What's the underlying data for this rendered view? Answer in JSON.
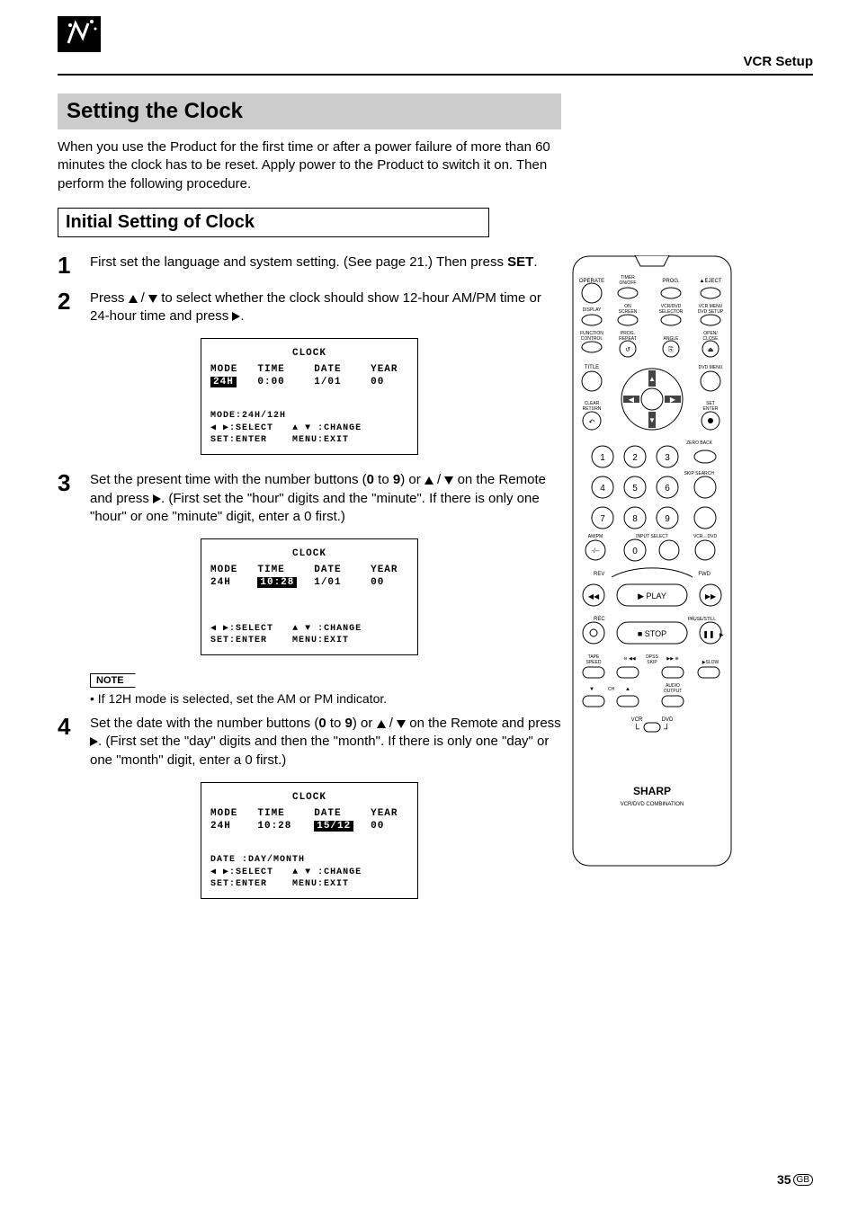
{
  "header": {
    "section": "VCR Setup"
  },
  "title": "Setting the Clock",
  "intro": "When you use the Product for the first time or after a power failure of more than 60 minutes the clock has to be reset. Apply power to the Product to switch it on. Then perform the following procedure.",
  "subtitle": "Initial Setting of Clock",
  "steps": {
    "1": {
      "num": "1",
      "text_a": "First set the language and system setting. (See page 21.) Then press ",
      "text_b": "SET",
      "text_c": "."
    },
    "2": {
      "num": "2",
      "text_a": "Press ",
      "text_b": " to select whether the clock should show 12-hour AM/PM time or 24-hour time and press "
    },
    "3": {
      "num": "3",
      "text_a": "Set the present time with the number buttons (",
      "text_b": "0",
      "text_c": " to ",
      "text_d": "9",
      "text_e": ") or ",
      "text_f": " on the Remote and press ",
      "text_g": ". (First set the \"hour\" digits and the \"minute\". If there is only one \"hour\" or one \"minute\" digit, enter a 0 first.)"
    },
    "4": {
      "num": "4",
      "text_a": "Set the date with the number buttons (",
      "text_b": "0",
      "text_c": " to ",
      "text_d": "9",
      "text_e": ")  or ",
      "text_f": " on the Remote and press ",
      "text_g": ". (First set the \"day\" digits and then the \"month\". If there is only one \"day\" or one \"month\" digit, enter a 0 first.)"
    }
  },
  "osd": {
    "title": "CLOCK",
    "head": {
      "c1": "MODE",
      "c2": "TIME",
      "c3": "DATE",
      "c4": "YEAR"
    },
    "screen1": {
      "mode": "24H",
      "time": "0:00",
      "date": "1/01",
      "year": "00",
      "f1": "MODE:24H/12H",
      "f2a": ":SELECT",
      "f2b": ":CHANGE",
      "f3a": "SET:ENTER",
      "f3b": "MENU:EXIT"
    },
    "screen2": {
      "mode": "24H",
      "time": "10:28",
      "date": "1/01",
      "year": "00",
      "f2a": ":SELECT",
      "f2b": ":CHANGE",
      "f3a": "SET:ENTER",
      "f3b": "MENU:EXIT"
    },
    "screen3": {
      "mode": "24H",
      "time": "10:28",
      "date": "15/12",
      "year": "00",
      "f1": "DATE :DAY/MONTH",
      "f2a": ":SELECT",
      "f2b": ":CHANGE",
      "f3a": "SET:ENTER",
      "f3b": "MENU:EXIT"
    }
  },
  "note": {
    "label": "NOTE",
    "text": "If 12H mode is selected, set the AM or PM indicator."
  },
  "remote": {
    "brand": "SHARP",
    "tag": "VCR/DVD COMBINATION",
    "labels": {
      "operate": "OPERATE",
      "timer": "TIMER\nON/OFF",
      "prog": "PROG.",
      "eject": "EJECT",
      "display": "DISPLAY",
      "onscreen": "ON\nSCREEN",
      "vcrdvd_sel": "VCR/DVD\nSELECTOR",
      "vcrmenu": "VCR MENU\nDVD SETUP",
      "function": "FUNCTION\nCONTROL",
      "prog_repeat": "PROG.\nREPEAT",
      "angle": "ANGLE",
      "open": "OPEN/\nCLOSE",
      "title": "TITLE",
      "dvdmenu": "DVD MENU",
      "clear": "CLEAR\nRETURN",
      "set": "SET\nENTER",
      "zero": "ZERO BACK",
      "skipsearch": "SKIP SEARCH",
      "ampm": "AM/PM",
      "inputselect": "INPUT SELECT",
      "vcrdvd": "VCR ↔ DVD",
      "rev": "REV",
      "fwd": "FWD",
      "play": "PLAY",
      "rec": "REC",
      "stop": "STOP",
      "pause": "PAUSE/STILL",
      "tape": "TAPE\nSPEED",
      "dpss": "DPSS",
      "skip": "SKIP",
      "slow": "SLOW",
      "ch": "CH",
      "audio": "AUDIO\nOUTPUT",
      "vcr": "VCR",
      "dvd": "DVD"
    }
  },
  "page_number": "35",
  "page_lang": "GB"
}
